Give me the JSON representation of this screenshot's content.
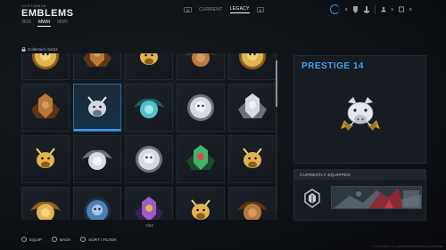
{
  "header": {
    "breadcrumb": "CUSTOMIZE",
    "title": "EMBLEMS",
    "game_tabs": [
      {
        "label": "BO6",
        "active": false
      },
      {
        "label": "MWIII",
        "active": true
      },
      {
        "label": "MWII",
        "active": false
      }
    ],
    "mid_tabs": {
      "left_key": "Q",
      "current": "CURRENT",
      "legacy": "LEGACY",
      "right_key": "E",
      "active": "legacy"
    },
    "status": {
      "level": "5",
      "count_a": "5",
      "count_b": "5",
      "accent": "#3e8de0"
    }
  },
  "collection": {
    "label": "Collected | 54/54"
  },
  "grid": {
    "selected_index": 6,
    "emblems": [
      {
        "name": "gold-skull-wreath-emblem",
        "metal": "gold"
      },
      {
        "name": "bronze-shield-emblem",
        "metal": "bronze"
      },
      {
        "name": "gold-shield-gems-emblem",
        "metal": "gold"
      },
      {
        "name": "bronze-wings-emblem",
        "metal": "bronze"
      },
      {
        "name": "gold-crest-emblem",
        "metal": "gold"
      },
      {
        "name": "bronze-skull-medal-emblem",
        "metal": "bronze"
      },
      {
        "name": "silver-boar-emblem",
        "metal": "silver"
      },
      {
        "name": "teal-skull-medal-emblem",
        "metal": "teal"
      },
      {
        "name": "silver-wreath-medal-emblem",
        "metal": "silver"
      },
      {
        "name": "silver-wolf-medal-emblem",
        "metal": "silver"
      },
      {
        "name": "gold-purple-skull-wings-emblem",
        "metal": "gold"
      },
      {
        "name": "silver-bull-skull-emblem",
        "metal": "silver"
      },
      {
        "name": "silver-wolf-emblem",
        "metal": "silver"
      },
      {
        "name": "green-red-cyber-skull-emblem",
        "metal": "green"
      },
      {
        "name": "gold-purple-wolf-wings-emblem",
        "metal": "gold"
      },
      {
        "name": "gold-purple-medal-emblem",
        "metal": "gold"
      },
      {
        "name": "blue-dark-crest-emblem",
        "metal": "blue"
      },
      {
        "name": "purple-skull-medal-emblem",
        "metal": "purple"
      },
      {
        "name": "gold-arc-emblem",
        "metal": "gold"
      },
      {
        "name": "bronze-banner-emblem",
        "metal": "bronze"
      }
    ],
    "pager": "7/54"
  },
  "detail": {
    "title": "PRESTIGE 14",
    "title_color": "#42a4f0"
  },
  "equipped": {
    "label": "CURRENTLY EQUIPPED"
  },
  "footer": {
    "buttons": [
      {
        "icon": "a-button-icon",
        "label": "EQUIP"
      },
      {
        "icon": "b-button-icon",
        "label": "BACK"
      },
      {
        "icon": "y-button-icon",
        "label": "SORT / FILTER"
      }
    ],
    "build": "9.1.11970931.2.1.1.1234567890123456789 [NA-23000000]"
  }
}
